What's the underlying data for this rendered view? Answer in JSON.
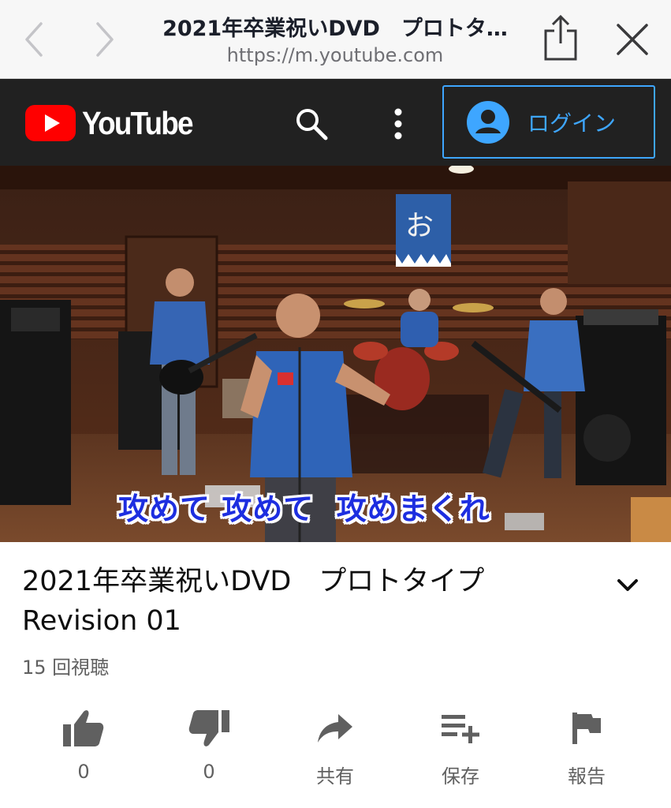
{
  "browser": {
    "page_title": "2021年卒業祝いDVD　プロトタ…",
    "url": "https://m.youtube.com"
  },
  "header": {
    "logo_text": "YouTube",
    "login_label": "ログイン"
  },
  "video": {
    "caption": "攻めて 攻めて  攻めまくれ",
    "banner_char": "お"
  },
  "info": {
    "title_line1": "2021年卒業祝いDVD　プロトタイプ",
    "title_line2": "Revision 01",
    "views": "15 回視聴"
  },
  "actions": {
    "like_count": "0",
    "dislike_count": "0",
    "share_label": "共有",
    "save_label": "保存",
    "report_label": "報告"
  },
  "colors": {
    "youtube_red": "#ff0000",
    "header_bg": "#212121",
    "login_blue": "#3ea6ff"
  }
}
